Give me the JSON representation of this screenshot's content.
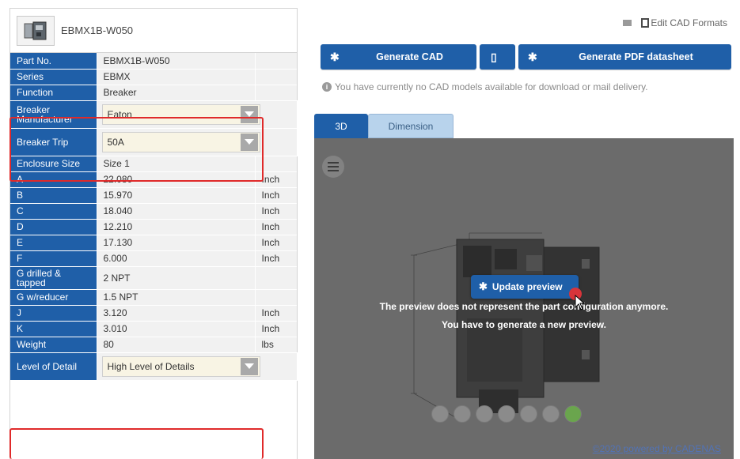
{
  "part": {
    "header_title": "EBMX1B-W050"
  },
  "properties": [
    {
      "label": "Part No.",
      "value": "EBMX1B-W050",
      "unit": ""
    },
    {
      "label": "Series",
      "value": "EBMX",
      "unit": ""
    },
    {
      "label": "Function",
      "value": "Breaker",
      "unit": ""
    },
    {
      "label": "Breaker Manufacturer",
      "value": "Eaton",
      "unit": "",
      "type": "select"
    },
    {
      "label": "Breaker Trip",
      "value": "50A",
      "unit": "",
      "type": "select"
    },
    {
      "label": "Enclosure Size",
      "value": "Size 1",
      "unit": ""
    },
    {
      "label": "A",
      "value": "22.080",
      "unit": "Inch"
    },
    {
      "label": "B",
      "value": "15.970",
      "unit": "Inch"
    },
    {
      "label": "C",
      "value": "18.040",
      "unit": "Inch"
    },
    {
      "label": "D",
      "value": "12.210",
      "unit": "Inch"
    },
    {
      "label": "E",
      "value": "17.130",
      "unit": "Inch"
    },
    {
      "label": "F",
      "value": "6.000",
      "unit": "Inch"
    },
    {
      "label": "G drilled & tapped",
      "value": "2 NPT",
      "unit": ""
    },
    {
      "label": "G w/reducer",
      "value": "1.5 NPT",
      "unit": ""
    },
    {
      "label": "J",
      "value": "3.120",
      "unit": "Inch"
    },
    {
      "label": "K",
      "value": "3.010",
      "unit": "Inch"
    },
    {
      "label": "Weight",
      "value": "80",
      "unit": "lbs"
    },
    {
      "label": "Level of Detail",
      "value": "High Level of Details",
      "unit": "",
      "type": "select"
    }
  ],
  "top_actions": {
    "edit_cad_formats": "Edit CAD Formats"
  },
  "buttons": {
    "generate_cad": "Generate CAD",
    "generate_pdf": "Generate PDF datasheet"
  },
  "info_message": "You have currently no CAD models available for download or mail delivery.",
  "tabs": {
    "tab_3d": "3D",
    "tab_dimension": "Dimension"
  },
  "viewport": {
    "update_preview": "Update preview",
    "message_line1": "The preview does not represent the part configuration anymore.",
    "message_line2": "You have to generate a new preview.",
    "powered_by": "©2020 powered by CADENAS"
  },
  "colors": {
    "primary_blue": "#1f5fa8",
    "highlight_red": "#e02a2a",
    "viewport_bg": "#6b6b6b"
  }
}
